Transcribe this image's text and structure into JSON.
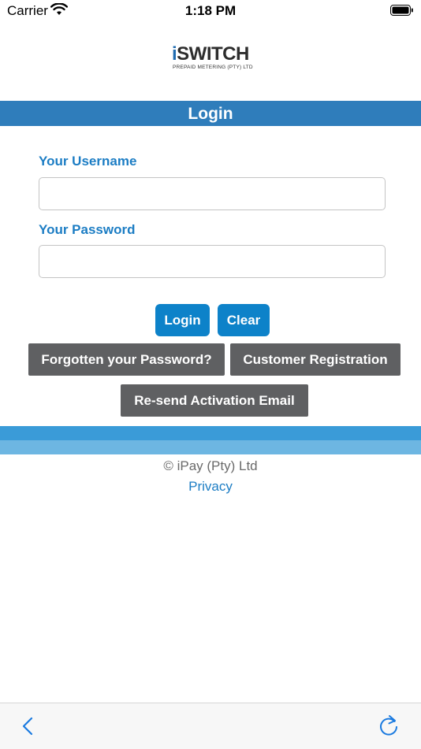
{
  "status_bar": {
    "carrier": "Carrier",
    "time": "1:18 PM",
    "wifi_icon": "wifi-icon",
    "battery_icon": "battery-icon"
  },
  "logo": {
    "brand_i": "i",
    "brand_rest": "SWITCH",
    "tagline": "PREPAID METERING (PTY) LTD"
  },
  "header": {
    "title": "Login"
  },
  "form": {
    "username_label": "Your Username",
    "username_value": "",
    "password_label": "Your Password",
    "password_value": ""
  },
  "buttons": {
    "login": "Login",
    "clear": "Clear",
    "forgot": "Forgotten your Password?",
    "register": "Customer Registration",
    "resend": "Re-send Activation Email"
  },
  "footer": {
    "copyright": "© iPay (Pty) Ltd",
    "privacy": "Privacy"
  },
  "toolbar": {
    "back_icon": "chevron-left-icon",
    "reload_icon": "reload-icon"
  },
  "colors": {
    "header_blue": "#2f7dbb",
    "label_blue": "#1c7dc4",
    "button_blue": "#0d82c9",
    "button_gray": "#5f6062",
    "band_dark": "#3a9bd8",
    "band_light": "#6db6e2"
  }
}
